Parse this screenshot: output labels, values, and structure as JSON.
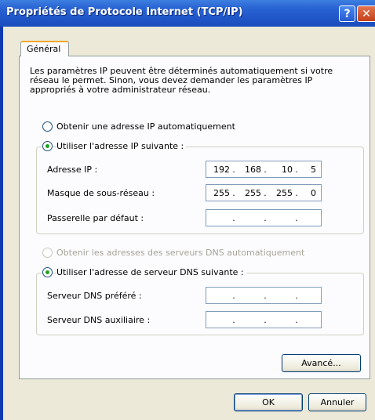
{
  "window": {
    "title": "Propriétés de Protocole Internet (TCP/IP)",
    "help_glyph": "?",
    "close_glyph": "✕"
  },
  "tabs": [
    {
      "label": "Général",
      "active": true
    }
  ],
  "description": "Les paramètres IP peuvent être déterminés automatiquement si votre réseau le permet. Sinon, vous devez demander les paramètres IP appropriés à votre administrateur réseau.",
  "ip_section": {
    "auto_label": "Obtenir une adresse IP automatiquement",
    "auto_selected": false,
    "manual_label": "Utiliser l'adresse IP suivante :",
    "manual_selected": true,
    "fields": [
      {
        "label": "Adresse IP :",
        "octets": [
          "192",
          "168",
          "10",
          "5"
        ]
      },
      {
        "label": "Masque de sous-réseau :",
        "octets": [
          "255",
          "255",
          "255",
          "0"
        ]
      },
      {
        "label": "Passerelle par défaut :",
        "octets": [
          "",
          "",
          "",
          ""
        ]
      }
    ]
  },
  "dns_section": {
    "auto_label": "Obtenir les adresses des serveurs DNS automatiquement",
    "auto_selected": false,
    "auto_disabled": true,
    "manual_label": "Utiliser l'adresse de serveur DNS suivante :",
    "manual_selected": true,
    "fields": [
      {
        "label": "Serveur DNS préféré :",
        "octets": [
          "",
          "",
          "",
          ""
        ]
      },
      {
        "label": "Serveur DNS auxiliaire :",
        "octets": [
          "",
          "",
          "",
          ""
        ]
      }
    ]
  },
  "buttons": {
    "advanced": "Avancé...",
    "ok": "OK",
    "cancel": "Annuler"
  },
  "colors": {
    "titlebar": "#2a64d4",
    "close_button": "#c3401a",
    "radio_selected": "#21a121",
    "tab_accent": "#f0a82c"
  }
}
